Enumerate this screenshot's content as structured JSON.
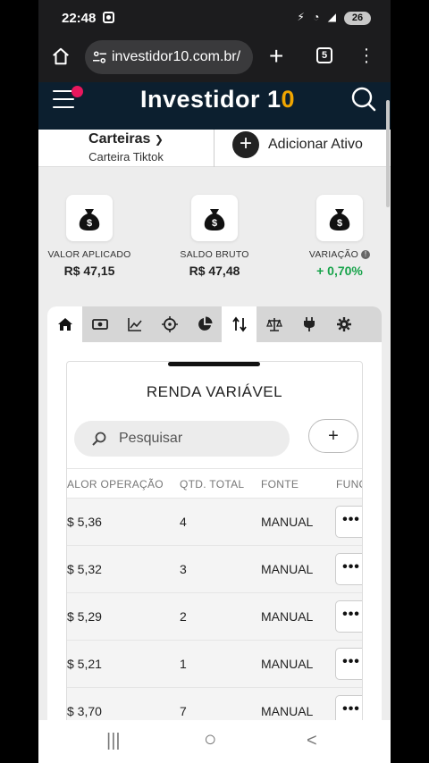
{
  "status": {
    "time": "22:48",
    "battery": "26",
    "icons": "⚡ ◔ ◢"
  },
  "browser": {
    "url": "investidor10.com.br/",
    "tab_count": "5",
    "new_tab": "+"
  },
  "site": {
    "logo_main": "Investidor 1",
    "logo_accent": "0"
  },
  "carteira": {
    "title": "Carteiras",
    "subtitle": "Carteira Tiktok",
    "add_label": "Adicionar Ativo",
    "add_icon": "+"
  },
  "stats": [
    {
      "label": "VALOR APLICADO",
      "value": "R$ 47,15",
      "icon": "money-bag-icon"
    },
    {
      "label": "SALDO BRUTO",
      "value": "R$ 47,48",
      "icon": "money-bag-icon"
    },
    {
      "label": "VARIAÇÃO",
      "value": "+ 0,70%",
      "icon": "money-bag-icon",
      "color": "#17a34a"
    }
  ],
  "tabs": [
    "home",
    "money",
    "chart",
    "target",
    "pie",
    "transfer",
    "balance",
    "plug",
    "settings"
  ],
  "panel": {
    "title": "RENDA VARIÁVEL",
    "search_placeholder": "Pesquisar",
    "add_label": "+",
    "columns": [
      "ALOR OPERAÇÃO",
      "QTD. TOTAL",
      "FONTE",
      "FUNÇ"
    ],
    "rows": [
      {
        "valor": "$ 5,36",
        "qtd": "4",
        "fonte": "MANUAL",
        "action": "•••"
      },
      {
        "valor": "$ 5,32",
        "qtd": "3",
        "fonte": "MANUAL",
        "action": "•••"
      },
      {
        "valor": "$ 5,29",
        "qtd": "2",
        "fonte": "MANUAL",
        "action": "•••"
      },
      {
        "valor": "$ 5,21",
        "qtd": "1",
        "fonte": "MANUAL",
        "action": "•••"
      },
      {
        "valor": "$ 3,70",
        "qtd": "7",
        "fonte": "MANUAL",
        "action": "•••"
      }
    ]
  },
  "colors": {
    "header_bg": "#0c1f2f",
    "accent": "#f0a500",
    "positive": "#17a34a",
    "notification": "#e8175d"
  },
  "navbar": {
    "recent": "|||",
    "home": "○",
    "back": "<"
  }
}
